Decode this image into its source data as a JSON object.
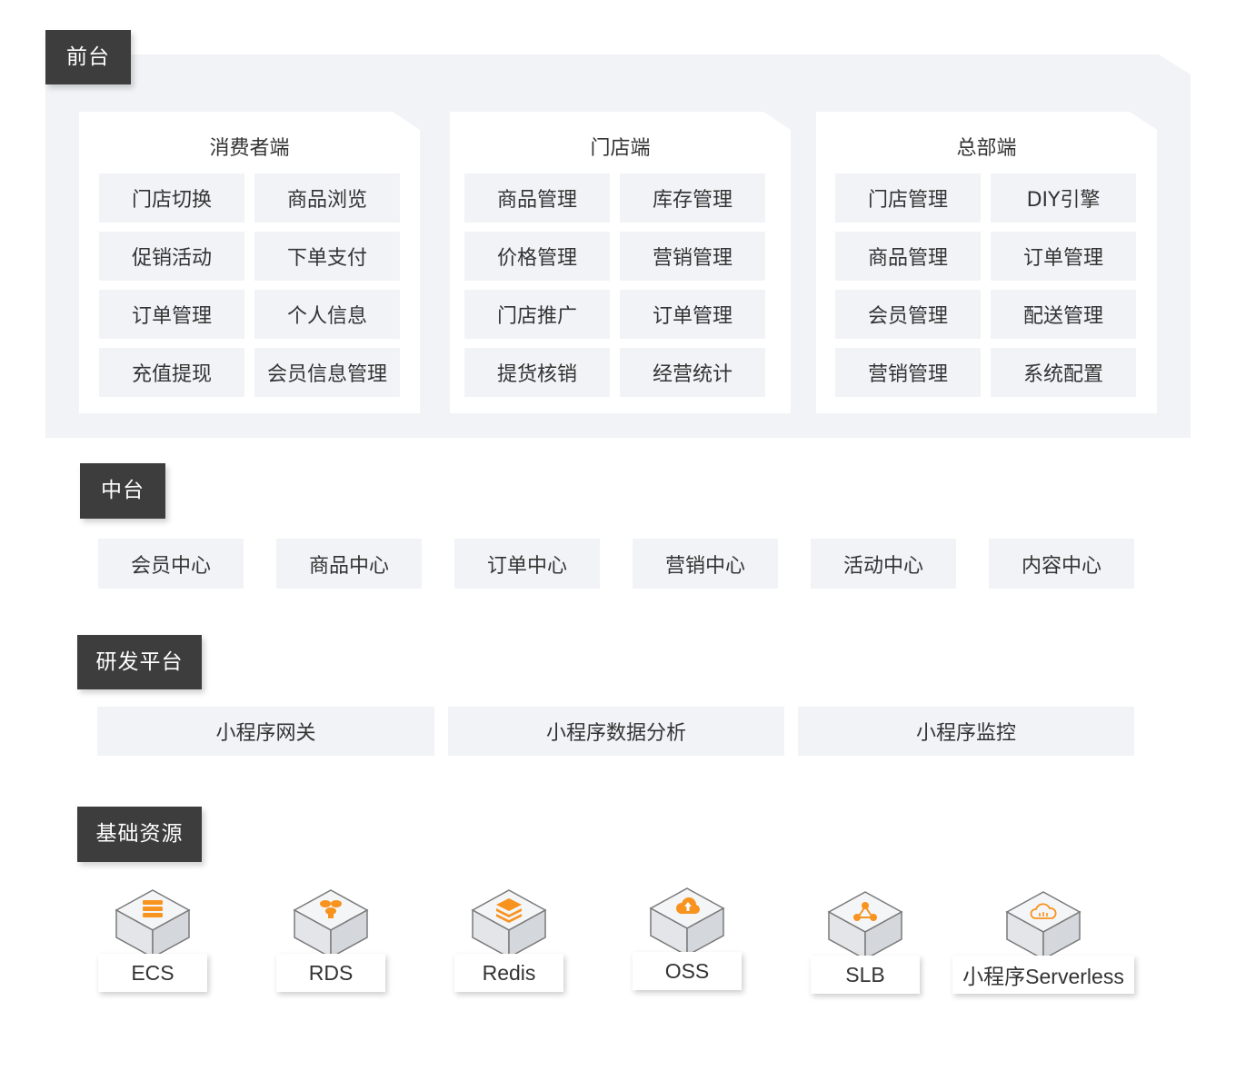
{
  "layers": {
    "front": {
      "label": "前台",
      "groups": [
        {
          "title": "消费者端",
          "items": [
            "门店切换",
            "商品浏览",
            "促销活动",
            "下单支付",
            "订单管理",
            "个人信息",
            "充值提现",
            "会员信息管理"
          ]
        },
        {
          "title": "门店端",
          "items": [
            "商品管理",
            "库存管理",
            "价格管理",
            "营销管理",
            "门店推广",
            "订单管理",
            "提货核销",
            "经营统计"
          ]
        },
        {
          "title": "总部端",
          "items": [
            "门店管理",
            "DIY引擎",
            "商品管理",
            "订单管理",
            "会员管理",
            "配送管理",
            "营销管理",
            "系统配置"
          ]
        }
      ]
    },
    "middle": {
      "label": "中台",
      "items": [
        "会员中心",
        "商品中心",
        "订单中心",
        "营销中心",
        "活动中心",
        "内容中心"
      ]
    },
    "devplatform": {
      "label": "研发平台",
      "items": [
        "小程序网关",
        "小程序数据分析",
        "小程序监控"
      ]
    },
    "infra": {
      "label": "基础资源",
      "items": [
        {
          "label": "ECS",
          "icon": "server-stack-icon"
        },
        {
          "label": "RDS",
          "icon": "database-cluster-icon"
        },
        {
          "label": "Redis",
          "icon": "redis-layers-icon"
        },
        {
          "label": "OSS",
          "icon": "cloud-upload-icon"
        },
        {
          "label": "SLB",
          "icon": "load-balancer-icon"
        },
        {
          "label": "小程序Serverless",
          "icon": "cloud-server-icon"
        }
      ]
    }
  },
  "colors": {
    "tag_bg": "#3d3d3d",
    "cell_bg": "#f1f3f6",
    "icon_accent": "#f7931e",
    "cube_top": "#f4f5f7",
    "cube_edge": "#7a7a7a"
  }
}
